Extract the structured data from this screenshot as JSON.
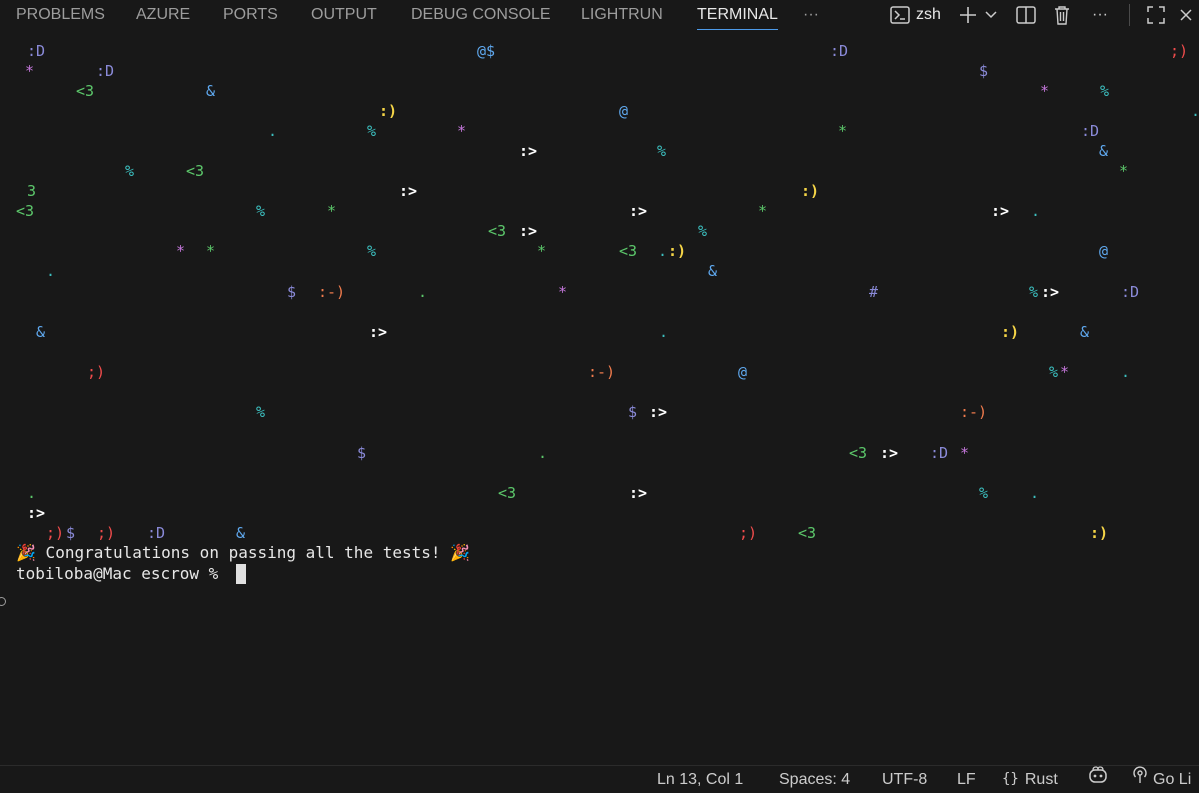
{
  "panel": {
    "tabs": [
      {
        "label": "PROBLEMS"
      },
      {
        "label": "AZURE"
      },
      {
        "label": "PORTS"
      },
      {
        "label": "OUTPUT"
      },
      {
        "label": "DEBUG CONSOLE"
      },
      {
        "label": "LIGHTRUN"
      },
      {
        "label": "TERMINAL"
      }
    ],
    "active_tab": "TERMINAL",
    "more_tabs": "···",
    "shell_name": "zsh",
    "more_actions": "···"
  },
  "terminal": {
    "glyphs": [
      {
        "t": ":D",
        "c": "#8a8ad8"
      },
      {
        "t": "@$",
        "c": "#5fa8ee"
      },
      {
        "t": ":D",
        "c": "#8a8ad8"
      },
      {
        "t": ";)",
        "c": "#f14c4c"
      },
      {
        "t": "*",
        "c": "#c678dd"
      },
      {
        "t": ":D",
        "c": "#8a8ad8"
      },
      {
        "t": "$",
        "c": "#8a8ad8"
      },
      {
        "t": "<3",
        "c": "#5cc86b"
      },
      {
        "t": "&",
        "c": "#5fa8ee"
      },
      {
        "t": "*",
        "c": "#c678dd"
      },
      {
        "t": "%",
        "c": "#3cbfbf"
      },
      {
        "t": ":)",
        "c": "#f5d547"
      },
      {
        "t": "@",
        "c": "#5fa8ee"
      },
      {
        "t": ".",
        "c": "#3cbfbf"
      },
      {
        "t": ".",
        "c": "#3cbfbf"
      },
      {
        "t": "%",
        "c": "#3cbfbf"
      },
      {
        "t": "*",
        "c": "#c678dd"
      },
      {
        "t": "*",
        "c": "#5cc86b"
      },
      {
        "t": ":D",
        "c": "#8a8ad8"
      },
      {
        "t": ":>",
        "c": "#ffffff"
      },
      {
        "t": "%",
        "c": "#3cbfbf"
      },
      {
        "t": "&",
        "c": "#5fa8ee"
      },
      {
        "t": "%",
        "c": "#3cbfbf"
      },
      {
        "t": "<3",
        "c": "#5cc86b"
      },
      {
        "t": "*",
        "c": "#5cc86b"
      },
      {
        "t": "3",
        "c": "#5cc86b"
      },
      {
        "t": ":>",
        "c": "#ffffff"
      },
      {
        "t": ":)",
        "c": "#f5d547"
      },
      {
        "t": "<3",
        "c": "#5cc86b"
      },
      {
        "t": "%",
        "c": "#3cbfbf"
      },
      {
        "t": "*",
        "c": "#5cc86b"
      },
      {
        "t": ":>",
        "c": "#ffffff"
      },
      {
        "t": "*",
        "c": "#5cc86b"
      },
      {
        "t": ":>",
        "c": "#ffffff"
      },
      {
        "t": ".",
        "c": "#3cbfbf"
      },
      {
        "t": "<3",
        "c": "#5cc86b"
      },
      {
        "t": ":>",
        "c": "#ffffff"
      },
      {
        "t": "%",
        "c": "#3cbfbf"
      },
      {
        "t": "*",
        "c": "#c678dd"
      },
      {
        "t": "*",
        "c": "#5cc86b"
      },
      {
        "t": "%",
        "c": "#3cbfbf"
      },
      {
        "t": "*",
        "c": "#5cc86b"
      },
      {
        "t": "<3",
        "c": "#5cc86b"
      },
      {
        "t": ".",
        "c": "#3cbfbf"
      },
      {
        "t": ":)",
        "c": "#f5d547"
      },
      {
        "t": "@",
        "c": "#5fa8ee"
      },
      {
        "t": ".",
        "c": "#3cbfbf"
      },
      {
        "t": "&",
        "c": "#5fa8ee"
      },
      {
        "t": "$",
        "c": "#8a8ad8"
      },
      {
        "t": ":-)",
        "c": "#f07b4d"
      },
      {
        "t": ".",
        "c": "#5cc86b"
      },
      {
        "t": "*",
        "c": "#c678dd"
      },
      {
        "t": "#",
        "c": "#8a8ad8"
      },
      {
        "t": "%",
        "c": "#3cbfbf"
      },
      {
        "t": ":>",
        "c": "#ffffff"
      },
      {
        "t": ":D",
        "c": "#8a8ad8"
      },
      {
        "t": "&",
        "c": "#5fa8ee"
      },
      {
        "t": ":>",
        "c": "#ffffff"
      },
      {
        "t": ".",
        "c": "#3cbfbf"
      },
      {
        "t": ":)",
        "c": "#f5d547"
      },
      {
        "t": "&",
        "c": "#5fa8ee"
      },
      {
        "t": ";)",
        "c": "#f14c4c"
      },
      {
        "t": ":-)",
        "c": "#f07b4d"
      },
      {
        "t": "@",
        "c": "#5fa8ee"
      },
      {
        "t": "%",
        "c": "#3cbfbf"
      },
      {
        "t": "*",
        "c": "#c678dd"
      },
      {
        "t": ".",
        "c": "#3cbfbf"
      },
      {
        "t": "%",
        "c": "#3cbfbf"
      },
      {
        "t": "$",
        "c": "#8a8ad8"
      },
      {
        "t": ":>",
        "c": "#ffffff"
      },
      {
        "t": ":-)",
        "c": "#f07b4d"
      },
      {
        "t": "$",
        "c": "#8a8ad8"
      },
      {
        "t": ".",
        "c": "#5cc86b"
      },
      {
        "t": "<3",
        "c": "#5cc86b"
      },
      {
        "t": ":>",
        "c": "#ffffff"
      },
      {
        "t": ":D",
        "c": "#8a8ad8"
      },
      {
        "t": "*",
        "c": "#c678dd"
      },
      {
        "t": ".",
        "c": "#5cc86b"
      },
      {
        "t": "<3",
        "c": "#5cc86b"
      },
      {
        "t": ":>",
        "c": "#ffffff"
      },
      {
        "t": "%",
        "c": "#3cbfbf"
      },
      {
        "t": ".",
        "c": "#3cbfbf"
      },
      {
        "t": ":>",
        "c": "#ffffff"
      },
      {
        "t": ";)",
        "c": "#f14c4c"
      },
      {
        "t": "$",
        "c": "#8a8ad8"
      },
      {
        "t": ";)",
        "c": "#f14c4c"
      },
      {
        "t": ":D",
        "c": "#8a8ad8"
      },
      {
        "t": "&",
        "c": "#5fa8ee"
      },
      {
        "t": ";)",
        "c": "#f14c4c"
      },
      {
        "t": "<3",
        "c": "#5cc86b"
      },
      {
        "t": ":)",
        "c": "#f5d547"
      }
    ],
    "message": "🎉 Congratulations on passing all the tests! 🎉",
    "prompt": "tobiloba@Mac escrow % "
  },
  "status": {
    "position": "Ln 13, Col 1",
    "spaces": "Spaces: 4",
    "encoding": "UTF-8",
    "eol": "LF",
    "language": "Rust",
    "golive": "Go Li"
  }
}
